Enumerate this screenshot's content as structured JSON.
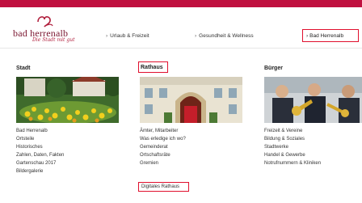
{
  "colors": {
    "accent": "#c0103f",
    "highlight": "#e0102e"
  },
  "brand": {
    "name": "bad herrenalb",
    "tagline": "Die Stadt mit gut"
  },
  "nav": {
    "items": [
      {
        "label": "Urlaub & Freizeit"
      },
      {
        "label": "Gesundheit & Wellness"
      }
    ],
    "active": {
      "label": "Bad Herrenalb"
    }
  },
  "columns": [
    {
      "title": "Stadt",
      "links": [
        "Bad Herrenalb",
        "Ortsteile",
        "Historisches",
        "Zahlen, Daten, Fakten",
        "Gartenschau 2017",
        "Bildergalerie"
      ]
    },
    {
      "title": "Rathaus",
      "links": [
        "Ämter, Mitarbeiter",
        "Was erledige ich wo?",
        "Gemeinderat",
        "Ortschaftsräte",
        "Gremien",
        "Digitales Rathaus"
      ]
    },
    {
      "title": "Bürger",
      "links": [
        "Freizeit & Vereine",
        "Bildung & Soziales",
        "Stadtwerke",
        "Handel & Gewerbe",
        "Notrufnummern & Kliniken"
      ]
    }
  ]
}
